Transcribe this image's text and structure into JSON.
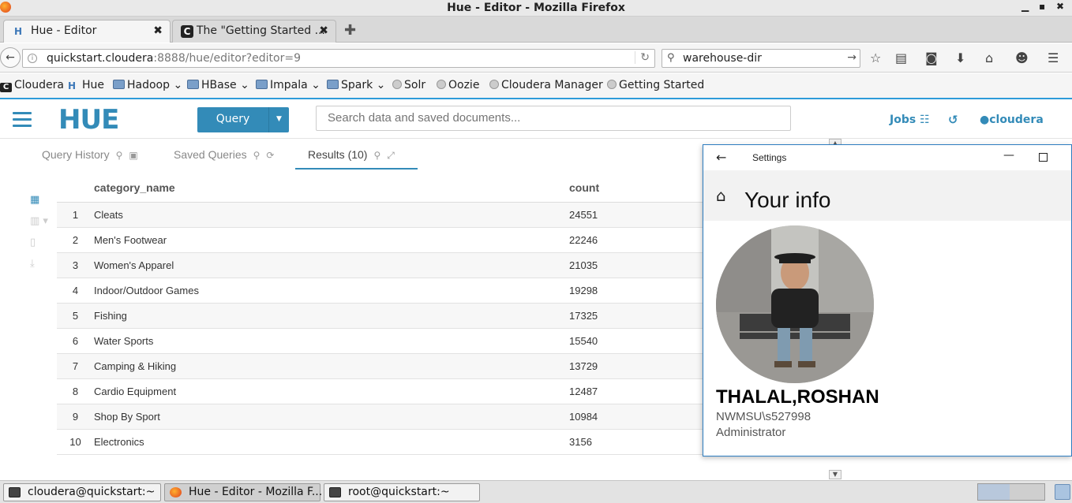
{
  "window": {
    "title": "Hue - Editor - Mozilla Firefox"
  },
  "browser": {
    "tabs": [
      {
        "label": "Hue - Editor",
        "close": "✖"
      },
      {
        "label": "The \"Getting Started ...",
        "close": "✖"
      }
    ],
    "url_host": "quickstart.cloudera",
    "url_path": ":8888/hue/editor?editor=9",
    "search_value": "warehouse-dir",
    "bookmarks": [
      {
        "label": "Cloudera",
        "icon": "cloudera-icon"
      },
      {
        "label": "Hue",
        "icon": "hue-icon"
      },
      {
        "label": "Hadoop",
        "icon": "folder-icon",
        "has_menu": true
      },
      {
        "label": "HBase",
        "icon": "folder-icon",
        "has_menu": true
      },
      {
        "label": "Impala",
        "icon": "folder-icon",
        "has_menu": true
      },
      {
        "label": "Spark",
        "icon": "folder-icon",
        "has_menu": true
      },
      {
        "label": "Solr",
        "icon": "globe-icon"
      },
      {
        "label": "Oozie",
        "icon": "globe-icon"
      },
      {
        "label": "Cloudera Manager",
        "icon": "globe-icon"
      },
      {
        "label": "Getting Started",
        "icon": "globe-icon"
      }
    ]
  },
  "hue": {
    "logo": "HUE",
    "query_label": "Query",
    "search_placeholder": "Search data and saved documents...",
    "jobs_label": "Jobs",
    "user": "cloudera",
    "result_tabs": {
      "query_history": "Query History",
      "saved_queries": "Saved Queries",
      "results": "Results (10)"
    },
    "columns": {
      "category": "category_name",
      "count": "count"
    },
    "rows": [
      {
        "n": "1",
        "category": "Cleats",
        "count": "24551"
      },
      {
        "n": "2",
        "category": "Men's Footwear",
        "count": "22246"
      },
      {
        "n": "3",
        "category": "Women's Apparel",
        "count": "21035"
      },
      {
        "n": "4",
        "category": "Indoor/Outdoor Games",
        "count": "19298"
      },
      {
        "n": "5",
        "category": "Fishing",
        "count": "17325"
      },
      {
        "n": "6",
        "category": "Water Sports",
        "count": "15540"
      },
      {
        "n": "7",
        "category": "Camping & Hiking",
        "count": "13729"
      },
      {
        "n": "8",
        "category": "Cardio Equipment",
        "count": "12487"
      },
      {
        "n": "9",
        "category": "Shop By Sport",
        "count": "10984"
      },
      {
        "n": "10",
        "category": "Electronics",
        "count": "3156"
      }
    ],
    "accent_color": "#338bb8"
  },
  "settings_window": {
    "title": "Settings",
    "heading": "Your info",
    "full_name": "THALAL,ROSHAN",
    "account": "NWMSU\\s527998",
    "role": "Administrator"
  },
  "taskbar": {
    "items": [
      {
        "label": "cloudera@quickstart:~",
        "icon": "terminal-icon"
      },
      {
        "label": "Hue - Editor - Mozilla F...",
        "icon": "firefox-icon"
      },
      {
        "label": "root@quickstart:~",
        "icon": "terminal-icon"
      }
    ]
  }
}
